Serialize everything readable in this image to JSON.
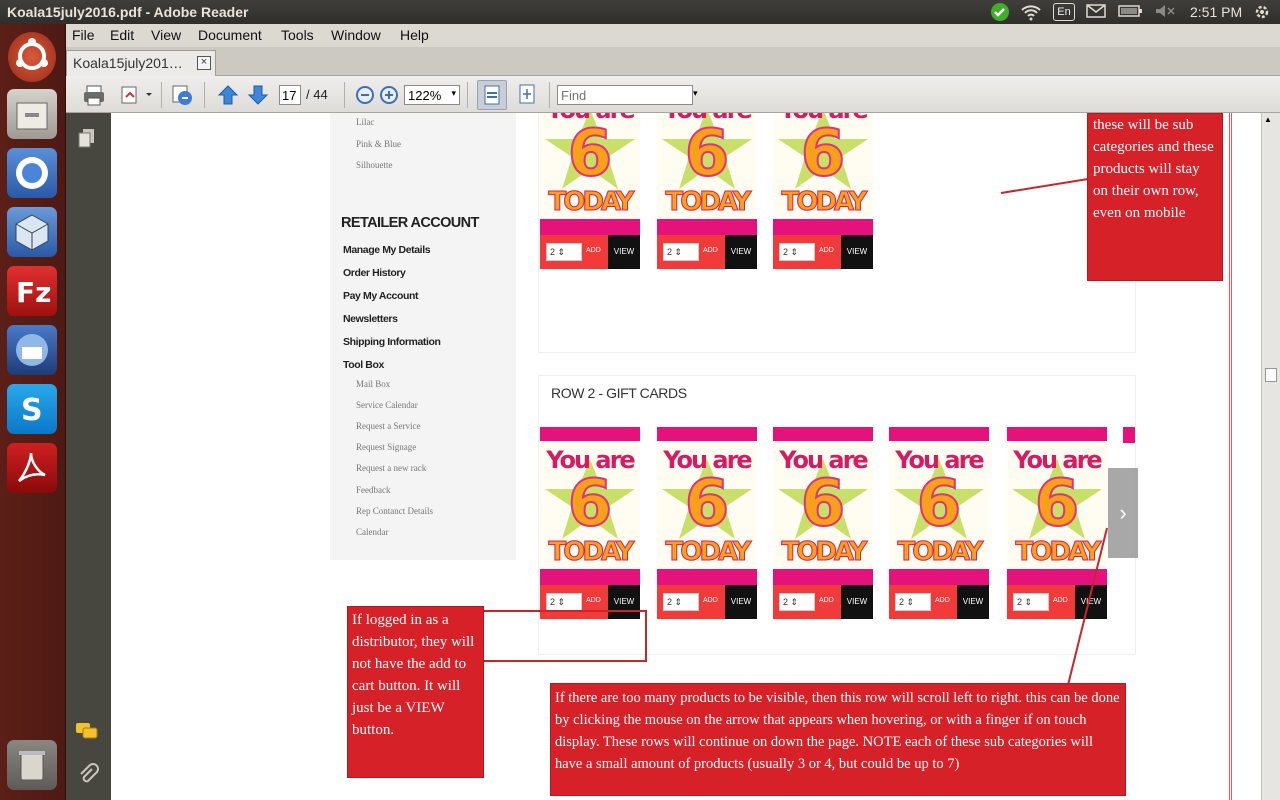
{
  "window": {
    "title": "Koala15july2016.pdf - Adobe Reader"
  },
  "tray": {
    "keyboard": "En",
    "time": "2:51 PM"
  },
  "menu": [
    "File",
    "Edit",
    "View",
    "Document",
    "Tools",
    "Window",
    "Help"
  ],
  "tab": {
    "label": "Koala15july201…",
    "close": "×"
  },
  "toolbar": {
    "page_current": "17",
    "page_total": "/ 44",
    "zoom": "122%",
    "find_placeholder": "Find"
  },
  "launcher": [
    "ubuntu-dash",
    "files",
    "chromium",
    "virtualbox",
    "filezilla",
    "thunderbird",
    "skype",
    "adobe-reader",
    "trash"
  ],
  "document": {
    "color_links": [
      "Lilac",
      "Pink & Blue",
      "Silhouette"
    ],
    "retailer": {
      "heading": "RETAILER ACCOUNT",
      "links": [
        "Manage My Details",
        "Order History",
        "Pay My Account",
        "Newsletters",
        "Shipping Information",
        "Tool Box"
      ],
      "toolbox_links": [
        "Mail Box",
        "Service Calendar",
        "Request a Service",
        "Request Signage",
        "Request a new rack",
        "Feedback",
        "Rep Contanct Details",
        "Calendar"
      ]
    },
    "card": {
      "line1": "You are",
      "line2": "6",
      "line3": "TODAY",
      "qty": "2 ⇕",
      "add": "ADD",
      "view": "VIEW"
    },
    "row2_title": "ROW 2 - GIFT CARDS",
    "notes": {
      "top": "these will be sub categories and these products will stay on their own row, even on mobile",
      "distributor": "If logged in as a distributor, they will not have the add to cart button. It will just be a VIEW button.",
      "scroll": "If there are too many products to be visible, then this row will scroll left to right. this can be done by clicking the mouse on the arrow that appears when hovering, or with a finger if on touch display. These rows will continue on down the page. NOTE each of these sub categories will have a small amount of products (usually 3 or 4, but could be up to 7)"
    }
  }
}
